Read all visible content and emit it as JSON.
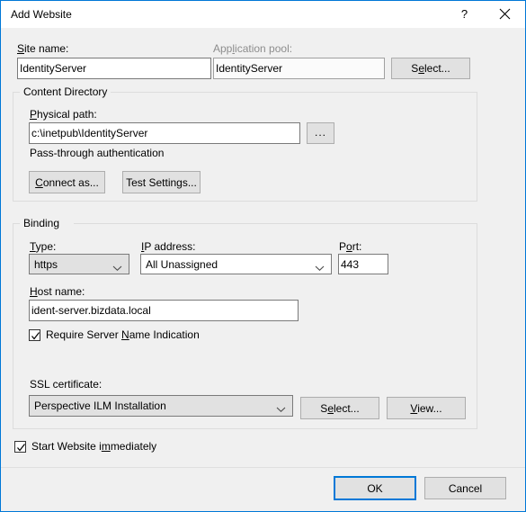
{
  "window": {
    "title": "Add Website",
    "help_icon": "question-mark-icon",
    "close_icon": "close-icon",
    "accent_color": "#0078d7",
    "body_color": "#f0f0f0"
  },
  "site": {
    "name_label_pre": "S",
    "name_label_accel": "",
    "name_label": "Site name:",
    "name_value": "IdentityServer",
    "pool_label": "Application pool:",
    "pool_value": "IdentityServer",
    "pool_select_button": "Select..."
  },
  "content_directory": {
    "legend": "Content Directory",
    "physical_path_label": "Physical path:",
    "physical_path_value": "c:\\inetpub\\IdentityServer",
    "browse_button": "...",
    "auth_text": "Pass-through authentication",
    "connect_as_button": "Connect as...",
    "test_settings_button": "Test Settings..."
  },
  "binding": {
    "legend": "Binding",
    "type_label": "Type:",
    "type_value": "https",
    "ip_label": "IP address:",
    "ip_value": "All Unassigned",
    "port_label": "Port:",
    "port_value": "443",
    "host_label": "Host name:",
    "host_value": "ident-server.bizdata.local",
    "sni_checkbox_label": "Require Server Name Indication",
    "sni_checked": true,
    "ssl_label": "SSL certificate:",
    "ssl_value": "Perspective ILM Installation",
    "ssl_select_button": "Select...",
    "ssl_view_button": "View..."
  },
  "footer": {
    "start_checkbox_label": "Start Website immediately",
    "start_checked": true,
    "ok_button": "OK",
    "cancel_button": "Cancel"
  }
}
